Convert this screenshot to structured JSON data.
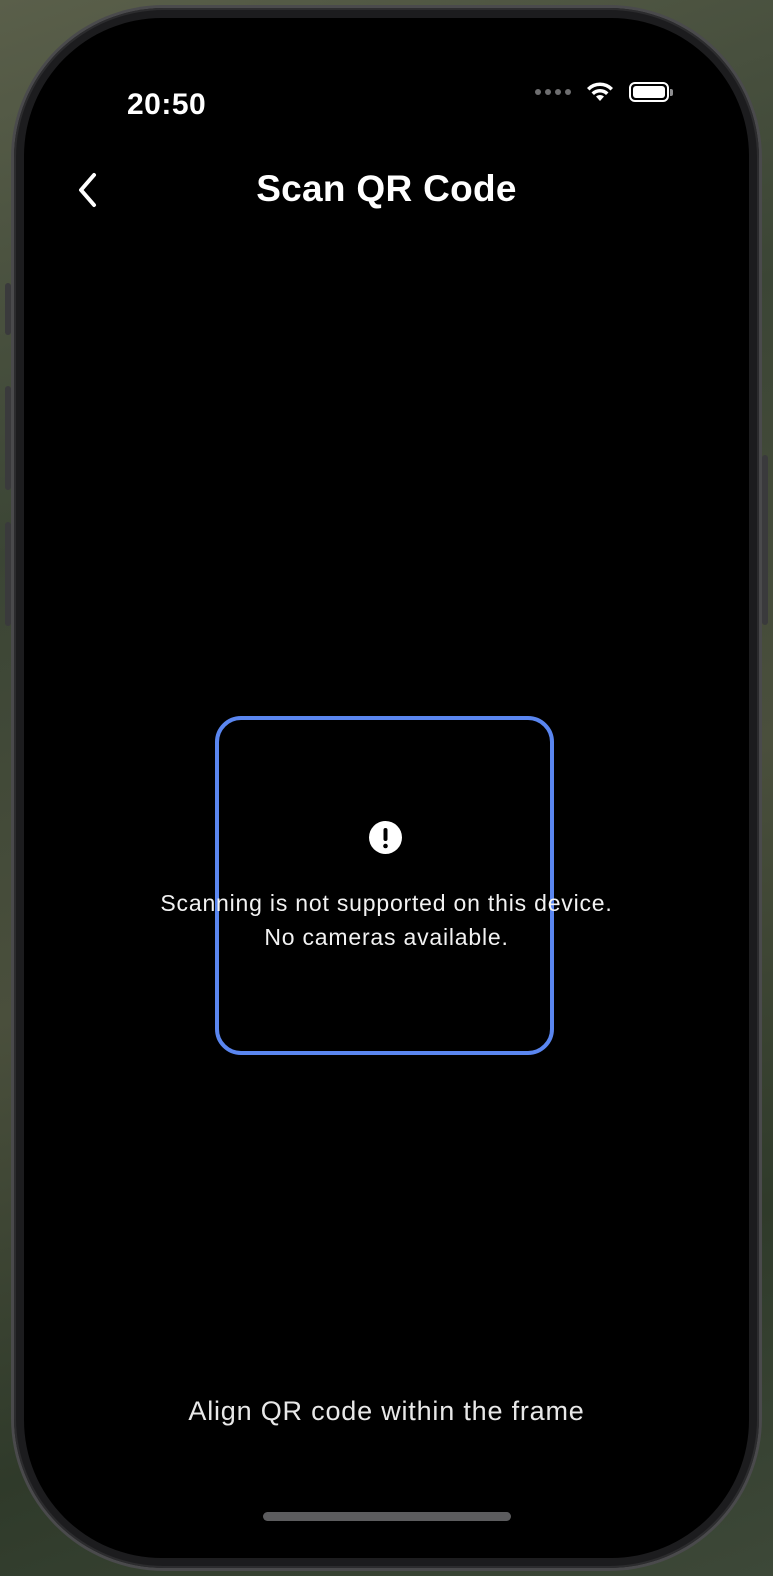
{
  "status_bar": {
    "time": "20:50",
    "signal_icon": "signal-dots-icon",
    "wifi_icon": "wifi-icon",
    "battery_icon": "battery-icon"
  },
  "nav": {
    "back_icon": "chevron-left-icon",
    "title": "Scan QR Code"
  },
  "scanner": {
    "frame_color": "#5a86f0",
    "error_icon": "exclamation-circle-icon",
    "error_line1": "Scanning is not supported on this device.",
    "error_line2": "No cameras available."
  },
  "footer": {
    "instruction": "Align QR code within the frame"
  },
  "colors": {
    "background": "#000000",
    "accent": "#5a86f0",
    "text": "#ffffff"
  }
}
